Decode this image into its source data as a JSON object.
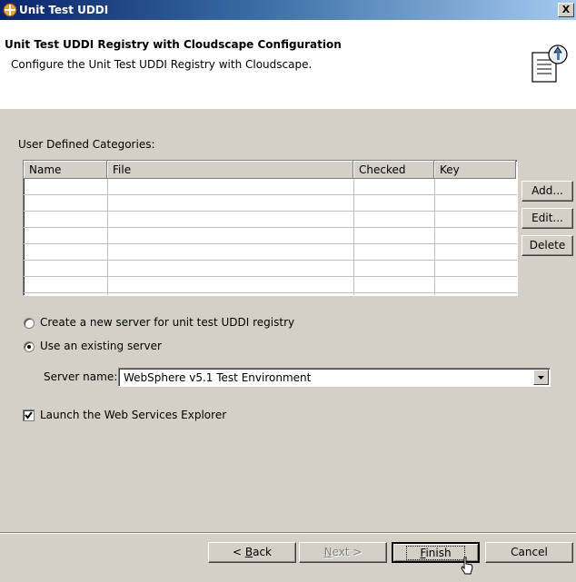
{
  "window": {
    "title": "Unit Test UDDI",
    "close_glyph": "X"
  },
  "banner": {
    "title": "Unit Test UDDI Registry with Cloudscape Configuration",
    "description": "Configure the Unit Test UDDI Registry with Cloudscape.",
    "icon": "wizard-document-icon"
  },
  "categories": {
    "label": "User Defined Categories:",
    "columns": [
      "Name",
      "File",
      "Checked",
      "Key"
    ],
    "rows": 7
  },
  "side_buttons": {
    "add": "Add...",
    "edit": "Edit...",
    "delete": "Delete"
  },
  "server_options": {
    "create_new": "Create a new server for unit test UDDI registry",
    "use_existing": "Use an existing server",
    "selected": "use_existing"
  },
  "server_name": {
    "label": "Server name:",
    "value": "WebSphere v5.1 Test Environment"
  },
  "launch_explorer": {
    "label": "Launch the Web Services Explorer",
    "checked": true
  },
  "footer": {
    "back_pre": "< ",
    "back_key": "B",
    "back_rest": "ack",
    "next_key": "N",
    "next_rest": "ext >",
    "finish_key": "F",
    "finish_rest": "inish",
    "cancel": "Cancel"
  }
}
